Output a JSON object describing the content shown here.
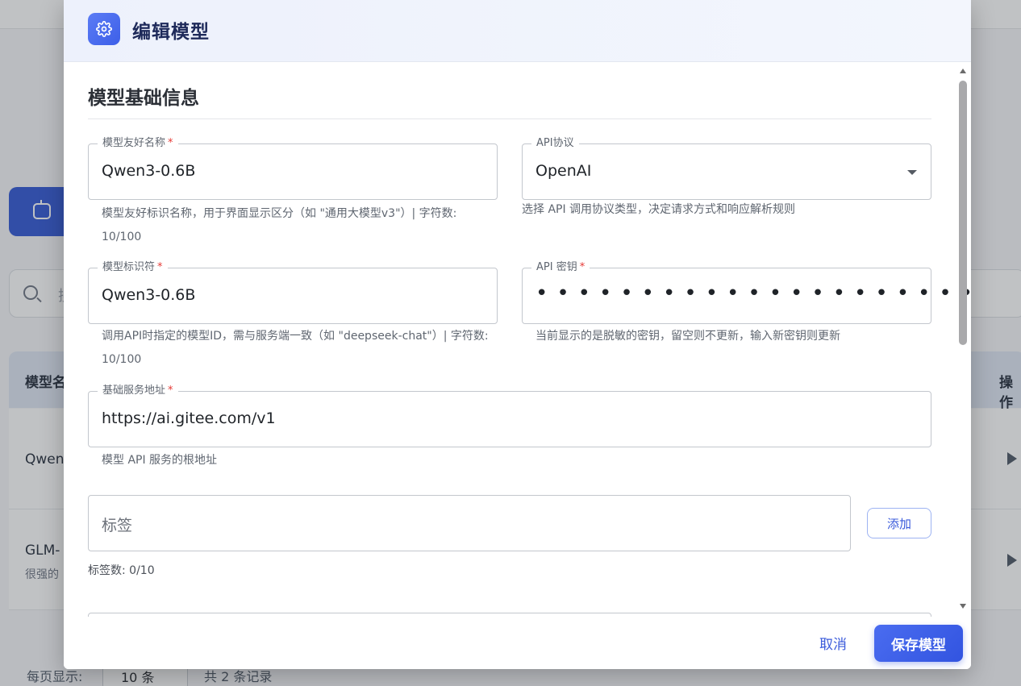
{
  "background": {
    "search_placeholder": "搜",
    "table_header_left": "模型名",
    "table_header_right": "操作",
    "row1_name": "Qwen",
    "row2_name": "GLM-",
    "row2_desc": "很强的",
    "per_page_label": "每页显示:",
    "per_page_value": "10 条",
    "total_label": "共 2 条记录"
  },
  "modal": {
    "title": "编辑模型",
    "header_icon": "gear-icon",
    "section_title": "模型基础信息",
    "fields": {
      "friendly_name": {
        "label": "模型友好名称",
        "required_mark": "*",
        "value": "Qwen3-0.6B",
        "helper": "模型友好标识名称，用于界面显示区分（如 \"通用大模型v3\"）| 字符数: 10/100"
      },
      "api_protocol": {
        "label": "API协议",
        "value": "OpenAI",
        "helper": "选择 API 调用协议类型，决定请求方式和响应解析规则"
      },
      "model_id": {
        "label": "模型标识符",
        "required_mark": "*",
        "value": "Qwen3-0.6B",
        "helper": "调用API时指定的模型ID，需与服务端一致（如 \"deepseek-chat\"）| 字符数: 10/100"
      },
      "api_key": {
        "label": "API 密钥",
        "required_mark": "*",
        "value": "•••••••••••••••••••••••",
        "helper": "当前显示的是脱敏的密钥，留空则不更新，输入新密钥则更新"
      },
      "base_url": {
        "label": "基础服务地址",
        "required_mark": "*",
        "value": "https://ai.gitee.com/v1",
        "helper": "模型 API 服务的根地址"
      },
      "tags": {
        "placeholder": "标签",
        "add_label": "添加",
        "count_label": "标签数: 0/10"
      }
    },
    "footer": {
      "cancel_label": "取消",
      "save_label": "保存模型"
    }
  },
  "colors": {
    "accent": "#3b5bdb",
    "required": "#e53935",
    "save_button": "#3254e0"
  }
}
